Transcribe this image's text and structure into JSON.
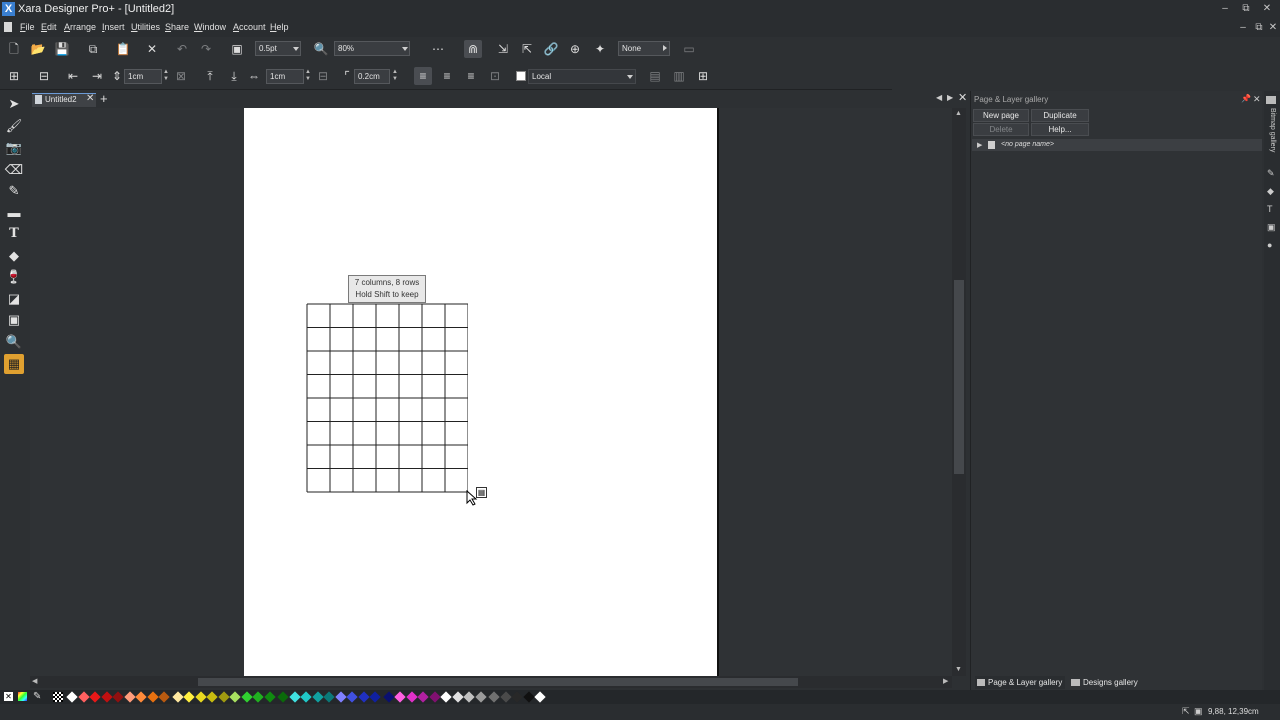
{
  "app": {
    "title": "Xara Designer Pro+ - [Untitled2]",
    "logo": "X"
  },
  "window_controls": {
    "minimize": "–",
    "restore": "⧉",
    "close": "✕"
  },
  "menu": [
    "File",
    "Edit",
    "Arrange",
    "Insert",
    "Utilities",
    "Share",
    "Window",
    "Account",
    "Help"
  ],
  "toolbar1": {
    "line_width": "0.5pt",
    "zoom": "80%",
    "arrowheads": "None"
  },
  "toolbar2": {
    "row_height": "1cm",
    "column_width": "1cm",
    "cell_padding": "0.2cm",
    "style": "Local"
  },
  "document": {
    "tab_label": "Untitled2",
    "new_tab": "+",
    "close_tab": "✕"
  },
  "tooltip": {
    "line1": "7 columns, 8 rows",
    "line2": "Hold Shift to keep"
  },
  "table": {
    "columns": 7,
    "rows": 8
  },
  "gallery": {
    "title": "Page & Layer gallery",
    "new_page": "New page",
    "duplicate": "Duplicate",
    "delete": "Delete",
    "help": "Help...",
    "item": "<no page name>",
    "tab_pages": "Page & Layer gallery",
    "tab_designs": "Designs gallery",
    "rail_label": "Bitmap gallery"
  },
  "status": {
    "coordinates": "9,88, 12,39cm"
  },
  "palette": [
    "#ffffff",
    "#ff6060",
    "#e81818",
    "#c01010",
    "#901010",
    "#ff9c7c",
    "#ff8a3a",
    "#e67010",
    "#b85a10",
    "#ffe8a0",
    "#ffef40",
    "#e8d820",
    "#c8bc10",
    "#a09a10",
    "#a8e060",
    "#30d030",
    "#20b020",
    "#108a10",
    "#0a6a0a",
    "#40e0e0",
    "#20c8c8",
    "#10a0a0",
    "#0a7878",
    "#8080ff",
    "#4050e0",
    "#2030c0",
    "#1020a0",
    "#0a1070",
    "#ff60e0",
    "#e030c8",
    "#b020a0",
    "#801070",
    "#ffffff",
    "#e0e0e0",
    "#c0c0c0",
    "#9a9a9a",
    "#707070",
    "#4a4a4a",
    "#282828",
    "#101010",
    "#ffffff"
  ]
}
